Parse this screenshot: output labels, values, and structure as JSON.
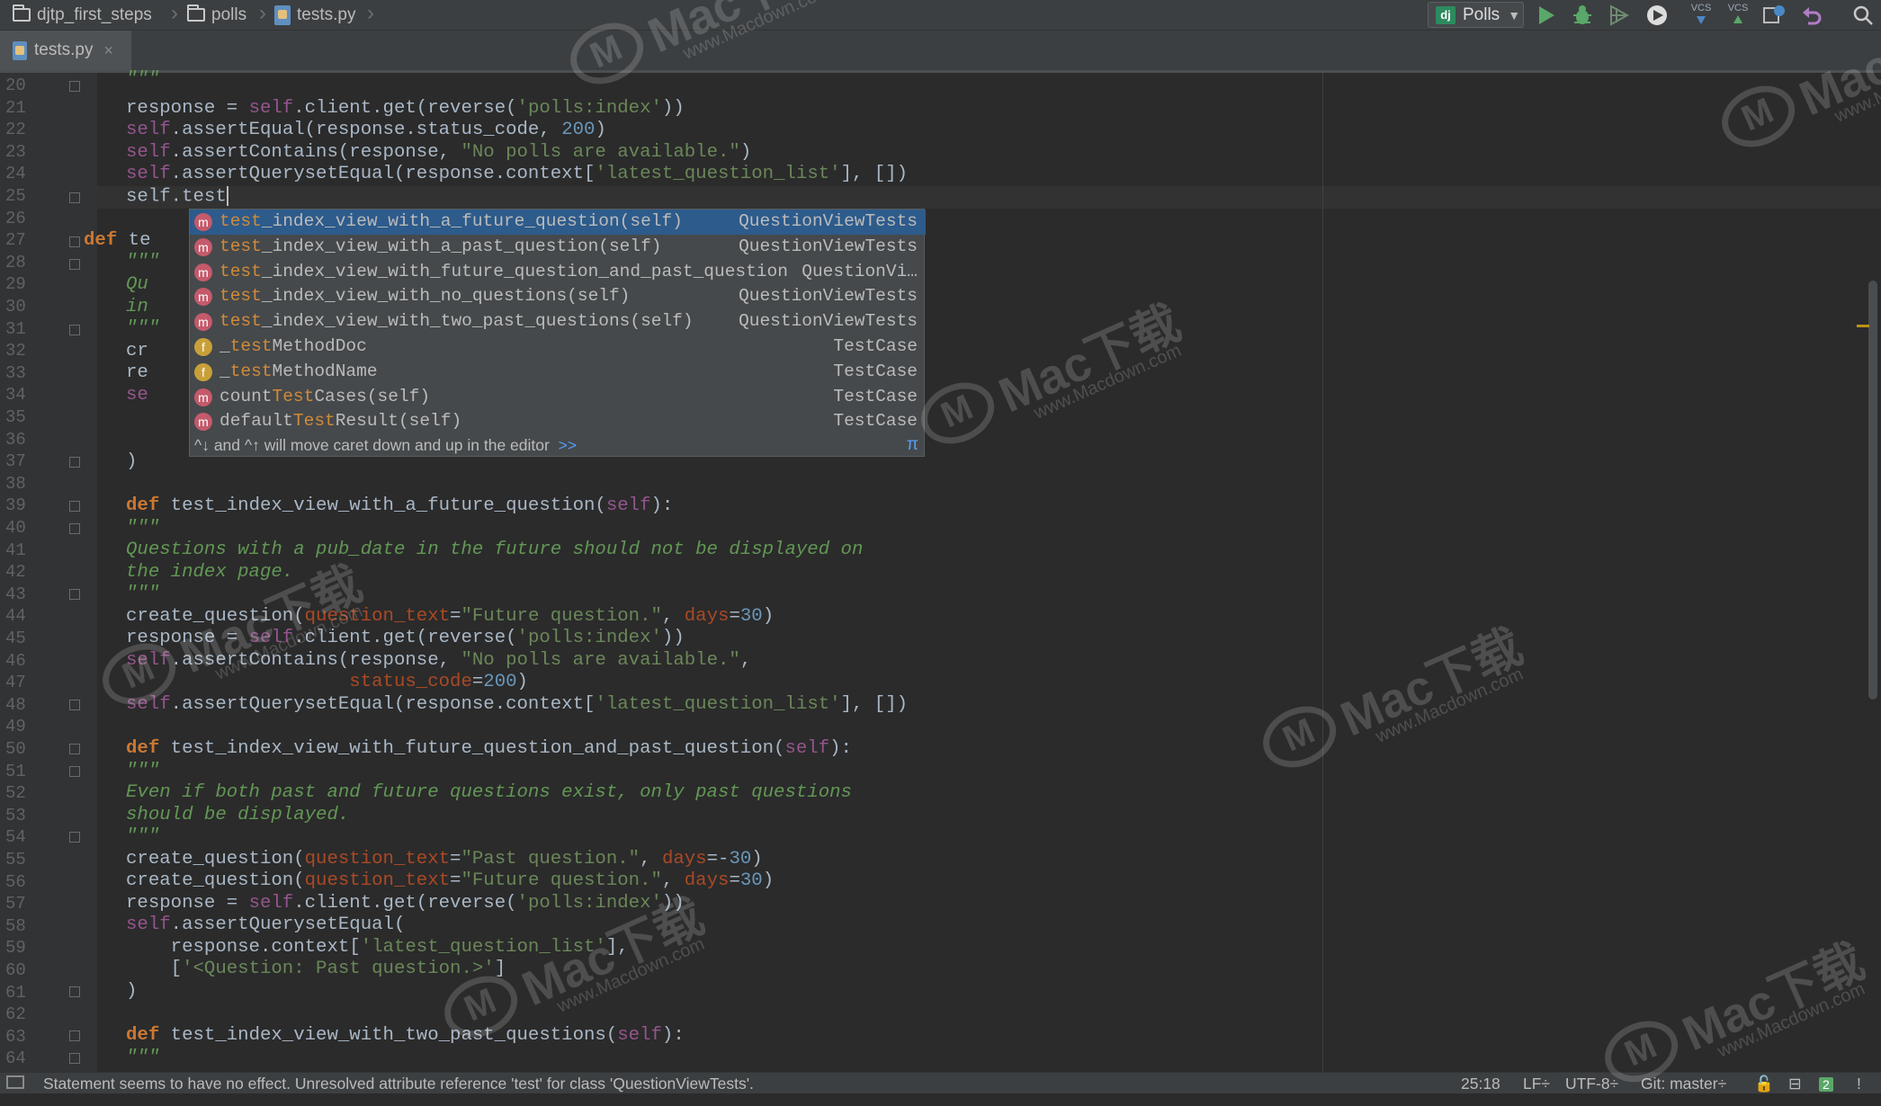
{
  "navbar": {
    "breadcrumbs": [
      "djtp_first_steps",
      "polls",
      "tests.py"
    ],
    "run_config": "Polls",
    "vcs_label_1": "VCS",
    "vcs_label_2": "VCS",
    "run_color": "#59a869"
  },
  "tabs": [
    {
      "label": "tests.py",
      "close": "×"
    }
  ],
  "editor": {
    "current_line_text": "self.test",
    "line_numbers": [
      "20",
      "21",
      "22",
      "23",
      "24",
      "25",
      "26",
      "27",
      "28",
      "29",
      "30",
      "31",
      "32",
      "33",
      "34",
      "35",
      "36",
      "37",
      "38",
      "39",
      "40",
      "41",
      "42",
      "43",
      "44",
      "45",
      "46",
      "47",
      "48",
      "49",
      "50",
      "51",
      "52",
      "53",
      "54",
      "55",
      "56",
      "57",
      "58",
      "59",
      "60",
      "61",
      "62",
      "63",
      "64"
    ]
  },
  "autocomplete": {
    "items": [
      {
        "kind": "m",
        "pre": "",
        "match": "test",
        "post": "_index_view_with_a_future_question(self)",
        "type": "QuestionViewTests"
      },
      {
        "kind": "m",
        "pre": "",
        "match": "test",
        "post": "_index_view_with_a_past_question(self)",
        "type": "QuestionViewTests"
      },
      {
        "kind": "m",
        "pre": "",
        "match": "test",
        "post": "_index_view_with_future_question_and_past_question",
        "type": "QuestionVi…"
      },
      {
        "kind": "m",
        "pre": "",
        "match": "test",
        "post": "_index_view_with_no_questions(self)",
        "type": "QuestionViewTests"
      },
      {
        "kind": "m",
        "pre": "",
        "match": "test",
        "post": "_index_view_with_two_past_questions(self)",
        "type": "QuestionViewTests"
      },
      {
        "kind": "f",
        "pre": "_",
        "match": "test",
        "post": "MethodDoc",
        "type": "TestCase"
      },
      {
        "kind": "f",
        "pre": "_",
        "match": "test",
        "post": "MethodName",
        "type": "TestCase"
      },
      {
        "kind": "m",
        "pre": "count",
        "match": "Test",
        "post": "Cases(self)",
        "type": "TestCase"
      },
      {
        "kind": "m",
        "pre": "default",
        "match": "Test",
        "post": "Result(self)",
        "type": "TestCase"
      }
    ],
    "hint": "^↓ and ^↑ will move caret down and up in the editor",
    "more": ">>",
    "pi": "π"
  },
  "statusbar": {
    "message": "Statement seems to have no effect. Unresolved attribute reference 'test' for class 'QuestionViewTests'.",
    "position": "25:18",
    "line_sep": "LF÷",
    "encoding": "UTF-8÷",
    "vcs": "Git: master÷",
    "badge": "2"
  },
  "watermarks": {
    "brand": "Mac下载",
    "site": "www.Macdown.com"
  }
}
